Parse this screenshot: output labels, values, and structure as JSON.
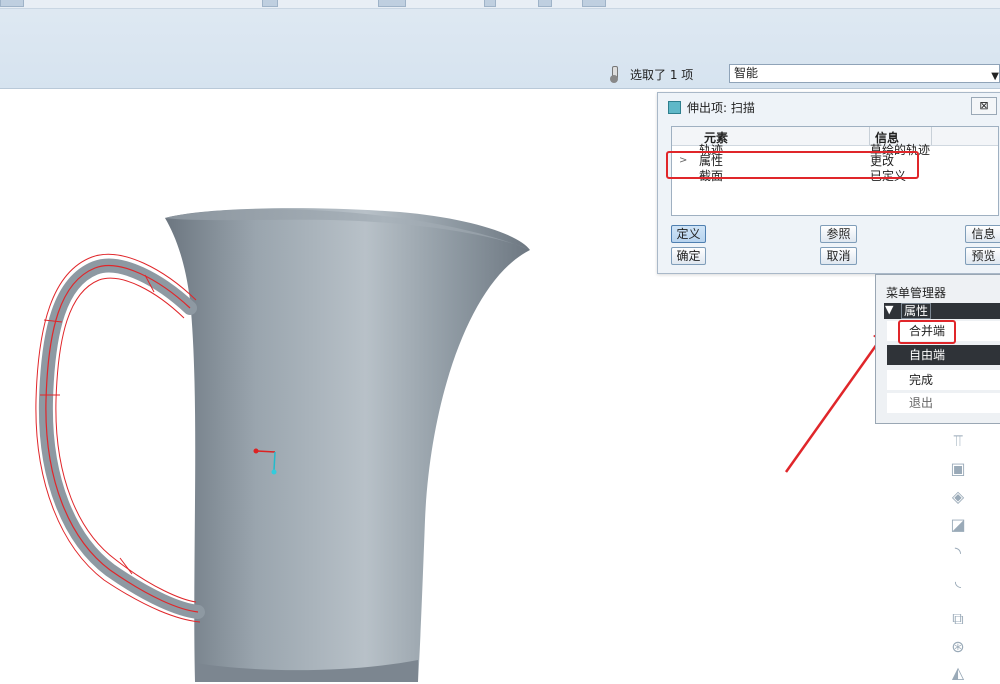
{
  "status_bar": {
    "selection_text": "选取了 1 项",
    "filter_value": "智能"
  },
  "feature_dialog": {
    "title": "伸出项: 扫描",
    "close_label": "⊠",
    "columns": [
      "元素",
      "信息"
    ],
    "rows": [
      {
        "element": "轨迹",
        "info": "草绘的轨迹"
      },
      {
        "element": "属性",
        "info": "更改",
        "current": true
      },
      {
        "element": "截面",
        "info": "已定义"
      }
    ],
    "buttons": {
      "define": "定义",
      "refs": "参照",
      "info": "信息",
      "ok": "确定",
      "cancel": "取消",
      "preview": "预览"
    }
  },
  "menu_manager": {
    "title": "菜单管理器",
    "header": "属性",
    "items": [
      {
        "label": "合并端",
        "selected": false
      },
      {
        "label": "自由端",
        "selected": true
      },
      {
        "label": "完成",
        "selected": false
      },
      {
        "label": "退出",
        "selected": false
      }
    ]
  },
  "colors": {
    "highlight_red": "#e0262a",
    "model_gray": "#8f9aa3",
    "toolbar_bg": "#dae6f1"
  },
  "icons": [
    "thermometer-icon",
    "dialog-icon",
    "close-icon",
    "collapse-triangle-icon",
    "view-tool-icons"
  ]
}
